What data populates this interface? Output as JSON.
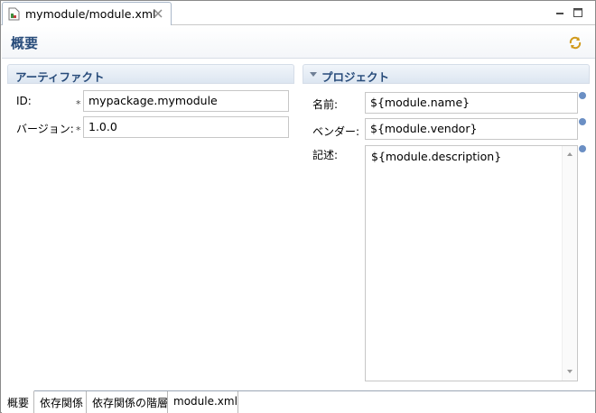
{
  "editor": {
    "tab_title": "mymodule/module.xml",
    "active_file_icon": "module-file-icon"
  },
  "form": {
    "title": "概要"
  },
  "artifact": {
    "section_title": "アーティファクト",
    "id_label": "ID:",
    "id_value": "mypackage.mymodule",
    "version_label": "バージョン:",
    "version_value": "1.0.0",
    "required_mark": "*"
  },
  "project": {
    "section_title": "プロジェクト",
    "name_label": "名前:",
    "name_value": "${module.name}",
    "vendor_label": "ベンダー:",
    "vendor_value": "${module.vendor}",
    "description_label": "記述:",
    "description_value": "${module.description}"
  },
  "bottom_tabs": [
    {
      "label": "概要",
      "active": true
    },
    {
      "label": "依存関係",
      "active": false
    },
    {
      "label": "依存関係の階層",
      "active": false
    },
    {
      "label": "module.xml",
      "active": false
    }
  ],
  "colors": {
    "section_title": "#274b7a",
    "info_icon": "#6b8fc4"
  }
}
